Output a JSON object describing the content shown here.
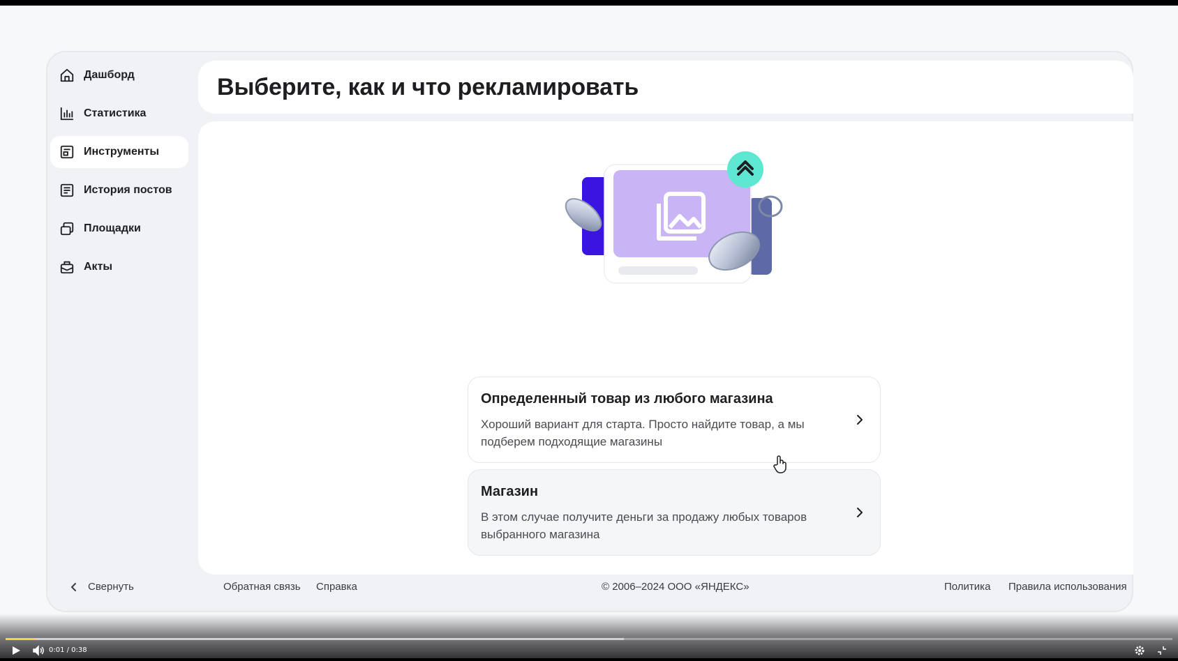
{
  "sidebar": {
    "items": [
      {
        "label": "Дашборд",
        "icon": "home-icon"
      },
      {
        "label": "Статистика",
        "icon": "bar-chart-icon"
      },
      {
        "label": "Инструменты",
        "icon": "tools-icon",
        "active": true
      },
      {
        "label": "История постов",
        "icon": "posts-history-icon"
      },
      {
        "label": "Площадки",
        "icon": "platforms-icon"
      },
      {
        "label": "Акты",
        "icon": "acts-icon"
      }
    ],
    "collapse_label": "Свернуть"
  },
  "header": {
    "title": "Выберите, как и что рекламировать"
  },
  "main": {
    "options": [
      {
        "title": "Определенный товар из любого магазина",
        "description": "Хороший вариант для старта. Просто найдите товар, а мы подберем подходящие магазины"
      },
      {
        "title": "Магазин",
        "description": "В этом случае получите деньги за продажу любых товаров выбранного магазина"
      }
    ]
  },
  "footer": {
    "feedback": "Обратная связь",
    "help": "Справка",
    "copyright": "© 2006–2024  ООО «ЯНДЕКС»",
    "policy": "Политика",
    "terms": "Правила использования"
  },
  "player": {
    "time": "0:01 / 0:38",
    "progress_fraction": 0.026,
    "buffer_fraction": 0.53
  },
  "colors": {
    "accent_purple": "#c9b5f5",
    "accent_blue": "#3a14e0",
    "accent_teal": "#5ee8d2",
    "progress_yellow": "#f7d23c"
  }
}
